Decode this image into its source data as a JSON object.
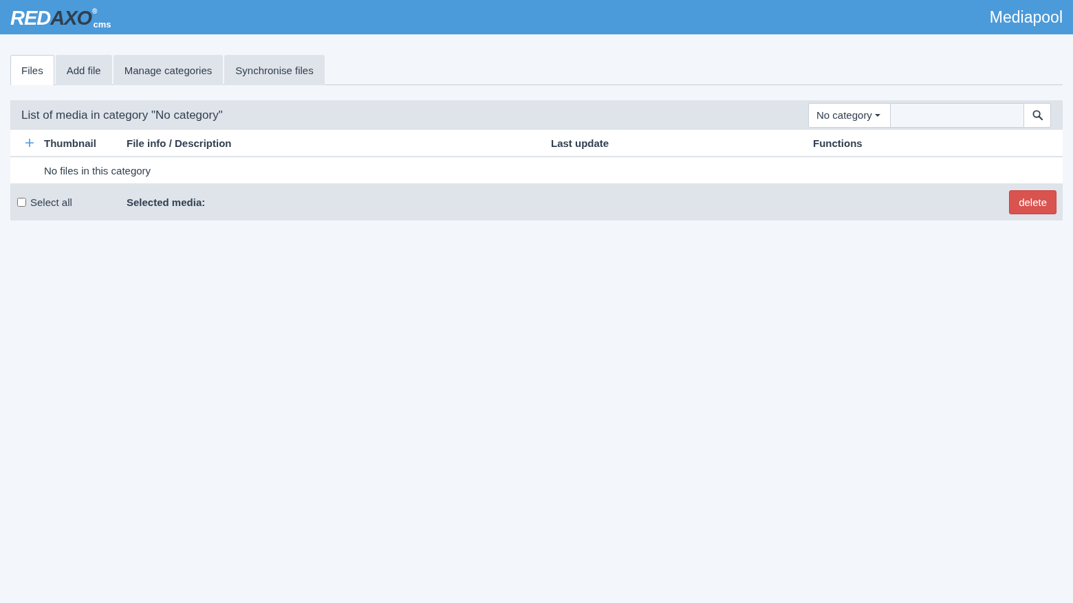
{
  "header": {
    "logo": {
      "part_1": "RED",
      "part_2": "AXO",
      "registered": "®",
      "suffix": "cms"
    },
    "title": "Mediapool"
  },
  "tabs": [
    {
      "label": "Files",
      "selected": true
    },
    {
      "label": "Add file",
      "selected": false
    },
    {
      "label": "Manage categories",
      "selected": false
    },
    {
      "label": "Synchronise files",
      "selected": false
    }
  ],
  "panel": {
    "title": "List of media in category \"No category\"",
    "category_dropdown": {
      "value": "No category"
    },
    "table": {
      "columns": [
        "Thumbnail",
        "File info / Description",
        "Last update",
        "Functions"
      ],
      "empty_message": "No files in this category"
    },
    "footer": {
      "select_all": {
        "label": "Select all",
        "checked": false
      },
      "selected_label": "Selected media:",
      "buttons": [
        {
          "label": "delete",
          "kind": "danger"
        }
      ]
    }
  }
}
